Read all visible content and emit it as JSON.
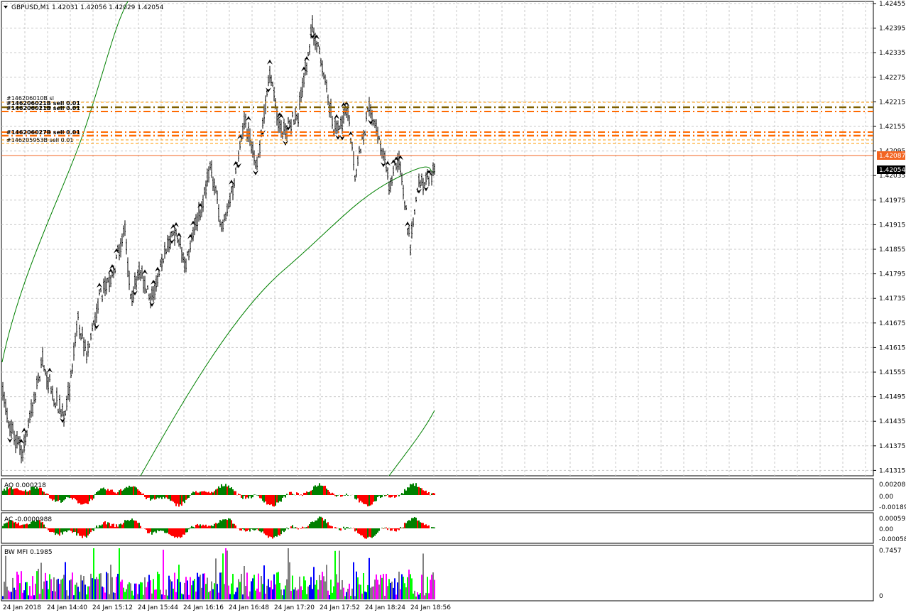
{
  "window": {
    "symbol_header": "GBPUSD,M1  1.42031 1.42056 1.42029 1.42054"
  },
  "main_chart": {
    "price_labels": [
      "1.42455",
      "1.42395",
      "1.42335",
      "1.42275",
      "1.42215",
      "1.42155",
      "1.42095",
      "1.42035",
      "1.41975",
      "1.41915",
      "1.41855",
      "1.41795",
      "1.41735",
      "1.41675",
      "1.41615",
      "1.41555",
      "1.41495",
      "1.41435",
      "1.41375",
      "1.41315"
    ],
    "current_price": "1.42054",
    "line_price": "1.42087",
    "order_labels": [
      "#146206010B sl",
      "#146206021B sell 0.01",
      "#146206021B sell 0.01",
      "#146206027B sell 0.01",
      "#146205953B sell 0.01"
    ],
    "colors": {
      "price_line": "#f36522",
      "order_line": "#ff6a00",
      "ma_line": "#008000",
      "bar": "#000000"
    }
  },
  "oscillators": [
    {
      "id": "ao",
      "label": "AO 0.000218",
      "scale": [
        "0.002086",
        "0.00",
        "-0.001894"
      ]
    },
    {
      "id": "ac",
      "label": "AC -0.0000988",
      "scale": [
        "0.000592",
        "0.00",
        "-0.000582"
      ]
    },
    {
      "id": "mfi",
      "label": "BW MFI 0.1985",
      "scale": [
        "0.7457",
        "0"
      ]
    }
  ],
  "time_axis": [
    "24 Jan 2018",
    "24 Jan 14:40",
    "24 Jan 15:12",
    "24 Jan 15:44",
    "24 Jan 16:16",
    "24 Jan 16:48",
    "24 Jan 17:20",
    "24 Jan 17:52",
    "24 Jan 18:24",
    "24 Jan 18:56"
  ],
  "colors": {
    "up": "#008000",
    "down": "#ff0000",
    "mfi_colors": [
      "#00ff00",
      "#ff00ff",
      "#0000ff",
      "#808080"
    ]
  }
}
